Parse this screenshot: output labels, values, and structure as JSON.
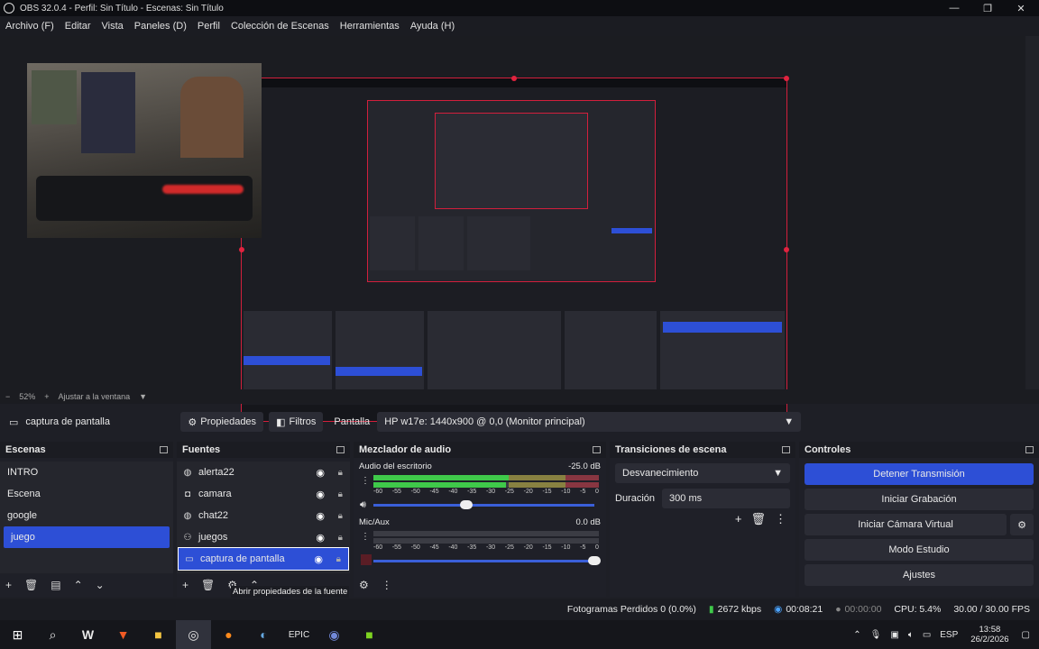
{
  "window": {
    "title": "OBS 32.0.4 - Perfil: Sin Título - Escenas: Sin Título",
    "minimize": "—",
    "maximize": "❐",
    "close": "✕"
  },
  "menu": [
    "Archivo (F)",
    "Editar",
    "Vista",
    "Paneles (D)",
    "Perfil",
    "Colección de Escenas",
    "Herramientas",
    "Ayuda (H)"
  ],
  "preview": {
    "zoom": "52%",
    "zoom_out": "−",
    "zoom_in": "+",
    "fit_label": "Ajustar a la ventana"
  },
  "source_bar": {
    "selected_source": "captura de pantalla",
    "properties": "Propiedades",
    "filters": "Filtros",
    "screen_label": "Pantalla",
    "screen_value": "HP w17e: 1440x900 @ 0,0 (Monitor principal)"
  },
  "scenes": {
    "title": "Escenas",
    "items": [
      "INTRO",
      "Escena",
      "google",
      "juego"
    ],
    "active": "juego"
  },
  "sources": {
    "title": "Fuentes",
    "items": [
      {
        "name": "alerta22",
        "icon": "globe-icon"
      },
      {
        "name": "camara",
        "icon": "camera-icon"
      },
      {
        "name": "chat22",
        "icon": "globe-icon"
      },
      {
        "name": "juegos",
        "icon": "gamepad-icon"
      },
      {
        "name": "captura de pantalla",
        "icon": "monitor-icon"
      }
    ],
    "active": "captura de pantalla",
    "tooltip": "Abrir propiedades de la fuente"
  },
  "mixer": {
    "title": "Mezclador de audio",
    "channels": [
      {
        "name": "Audio del escritorio",
        "db": "-25.0 dB",
        "level": 0.62,
        "volume": 0.42
      },
      {
        "name": "Mic/Aux",
        "db": "0.0 dB",
        "level": 0.0,
        "volume": 1.0
      }
    ],
    "ticks": [
      "-60",
      "-55",
      "-50",
      "-45",
      "-40",
      "-35",
      "-30",
      "-25",
      "-20",
      "-15",
      "-10",
      "-5",
      "0"
    ]
  },
  "transitions": {
    "title": "Transiciones de escena",
    "selected": "Desvanecimiento",
    "duration_label": "Duración",
    "duration_value": "300 ms"
  },
  "controls": {
    "title": "Controles",
    "buttons": [
      "Detener Transmisión",
      "Iniciar Grabación",
      "Iniciar Cámara Virtual",
      "Modo Estudio",
      "Ajustes"
    ]
  },
  "status": {
    "dropped": "Fotogramas Perdidos 0 (0.0%)",
    "bitrate": "2672 kbps",
    "stream_time": "00:08:21",
    "rec_time": "00:00:00",
    "cpu": "CPU: 5.4%",
    "fps": "30.00 / 30.00 FPS"
  },
  "taskbar": {
    "lang": "ESP",
    "time": "13:58",
    "date": "26/2/2026"
  }
}
